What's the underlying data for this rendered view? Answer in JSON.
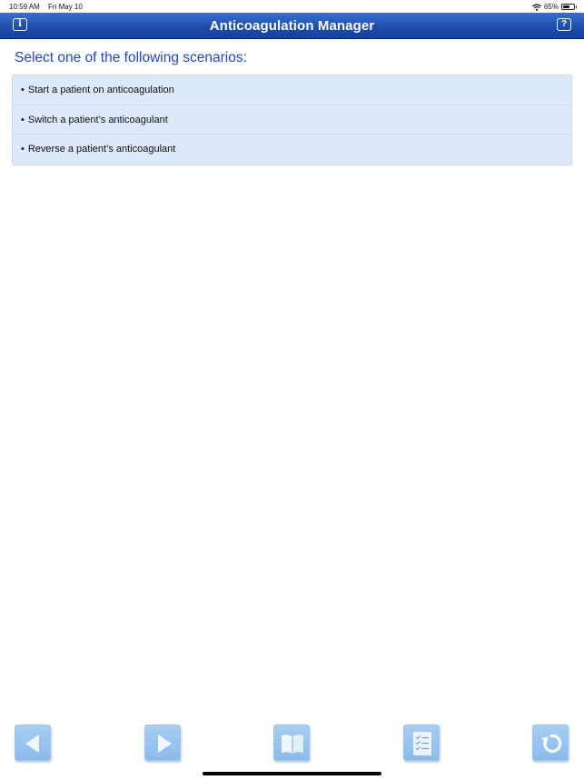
{
  "status_bar": {
    "time": "10:59 AM",
    "date": "Fri May 10",
    "battery": "65%",
    "battery_level": 0.65,
    "icons": [
      "wifi-icon",
      "battery-icon"
    ]
  },
  "header": {
    "title": "Anticoagulation Manager",
    "info_label": "i",
    "help_label": "?",
    "colors": {
      "bar": "#1e4fae",
      "text": "#ffffff"
    }
  },
  "main": {
    "heading": "Select one of the following scenarios:",
    "heading_color": "#2346c9",
    "list_background": "#dbe9fb",
    "scenarios": [
      {
        "label": "Start a patient on anticoagulation"
      },
      {
        "label": "Switch a patient’s anticoagulant"
      },
      {
        "label": "Reverse a patient’s anticoagulant"
      }
    ]
  },
  "toolbar": {
    "buttons": [
      {
        "icon": "arrow-left-icon"
      },
      {
        "icon": "arrow-right-icon"
      },
      {
        "icon": "book-icon"
      },
      {
        "icon": "checklist-icon"
      },
      {
        "icon": "refresh-icon"
      }
    ]
  }
}
